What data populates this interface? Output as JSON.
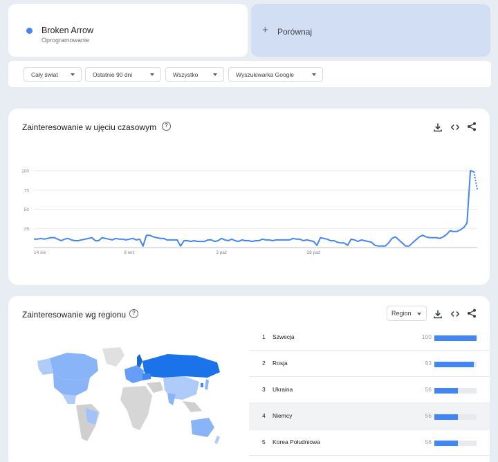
{
  "search_term": {
    "title": "Broken Arrow",
    "subtitle": "Oprogramowanie",
    "color": "#4285f4"
  },
  "compare": {
    "label": "Porównaj"
  },
  "filters": [
    {
      "label": "Cały świat"
    },
    {
      "label": "Ostatnie 90 dni"
    },
    {
      "label": "Wszystko"
    },
    {
      "label": "Wyszukiwarka Google"
    }
  ],
  "time_section": {
    "title": "Zainteresowanie w ujęciu czasowym",
    "icons": [
      "download-icon",
      "embed-icon",
      "share-icon"
    ]
  },
  "chart_data": {
    "type": "line",
    "title": "",
    "xlabel": "",
    "ylabel": "",
    "ylim": [
      0,
      100
    ],
    "yticks": [
      "100",
      "75",
      "50",
      "25"
    ],
    "x_tick_labels": [
      "14 sie",
      "8 wrz",
      "3 paź",
      "28 paź"
    ],
    "series": [
      {
        "color": "#4285f4",
        "values": [
          11,
          11,
          12,
          11,
          12,
          13,
          13,
          11,
          9,
          11,
          12,
          10,
          9,
          9,
          10,
          11,
          12,
          13,
          9,
          9,
          13,
          12,
          11,
          10,
          12,
          11,
          11,
          10,
          11,
          12,
          10,
          11,
          2,
          16,
          16,
          14,
          13,
          12,
          12,
          10,
          10,
          10,
          10,
          2,
          9,
          9,
          8,
          9,
          8,
          8,
          8,
          10,
          10,
          8,
          9,
          12,
          10,
          9,
          11,
          9,
          8,
          10,
          9,
          9,
          8,
          9,
          9,
          11,
          10,
          10,
          9,
          10,
          10,
          10,
          10,
          10,
          12,
          11,
          11,
          9,
          10,
          9,
          8,
          3,
          13,
          12,
          11,
          9,
          9,
          7,
          6,
          6,
          3,
          11,
          10,
          8,
          10,
          9,
          8,
          7,
          3,
          2,
          2,
          2,
          6,
          12,
          14,
          10,
          6,
          2,
          2,
          6,
          10,
          14,
          16,
          14,
          13,
          13,
          13,
          12,
          14,
          17,
          22,
          21,
          21,
          23,
          26,
          32,
          100,
          99,
          76
        ]
      }
    ]
  },
  "region_section": {
    "title": "Zainteresowanie wg regionu",
    "selector": "Region",
    "icons": [
      "download-icon",
      "embed-icon",
      "share-icon"
    ],
    "rows": [
      {
        "rank": "1",
        "name": "Szwecja",
        "value": "100",
        "pct": 100
      },
      {
        "rank": "2",
        "name": "Rosja",
        "value": "93",
        "pct": 93
      },
      {
        "rank": "3",
        "name": "Ukraina",
        "value": "56",
        "pct": 56
      },
      {
        "rank": "4",
        "name": "Niemcy",
        "value": "56",
        "pct": 56
      },
      {
        "rank": "5",
        "name": "Korea Południowa",
        "value": "56",
        "pct": 56
      }
    ]
  }
}
